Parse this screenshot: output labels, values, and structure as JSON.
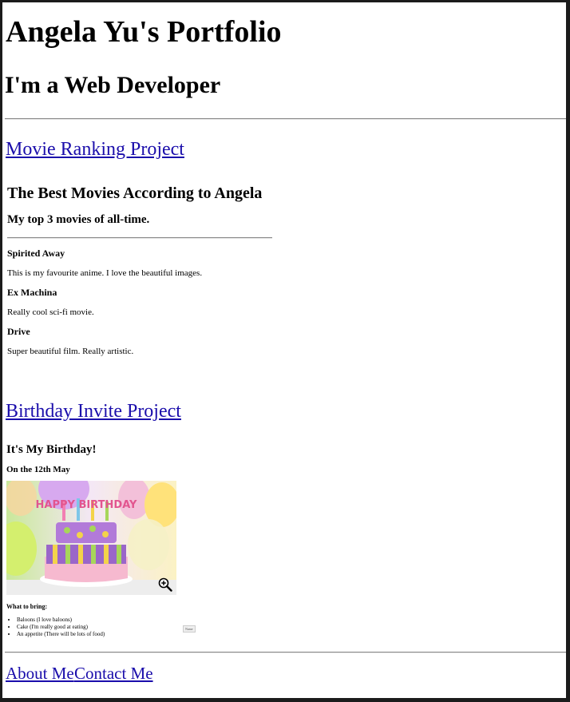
{
  "header": {
    "title": "Angela Yu's Portfolio",
    "subtitle": "I'm a Web Developer"
  },
  "movie_project": {
    "link_label": "Movie Ranking Project",
    "heading": "The Best Movies According to Angela",
    "subheading": "My top 3 movies of all-time.",
    "movies": [
      {
        "title": "Spirited Away",
        "description": "This is my favourite anime. I love the beautiful images."
      },
      {
        "title": "Ex Machina",
        "description": "Really cool sci-fi movie."
      },
      {
        "title": "Drive",
        "description": "Super beautiful film. Really artistic."
      }
    ]
  },
  "birthday_project": {
    "link_label": "Birthday Invite Project",
    "heading": "It's My Birthday!",
    "date": "On the 12th May",
    "image_sign_text": "HAPPY BIRTHDAY",
    "bring_heading": "What to bring:",
    "bring_items": [
      "Baloons (I love baloons)",
      "Cake (I'm really good at eating)",
      "An appetite (There will be lots of food)"
    ],
    "tiny_label": "Name"
  },
  "footer": {
    "links": [
      "About Me",
      "Contact Me"
    ]
  },
  "icons": {
    "zoom": "zoom-in-icon"
  }
}
